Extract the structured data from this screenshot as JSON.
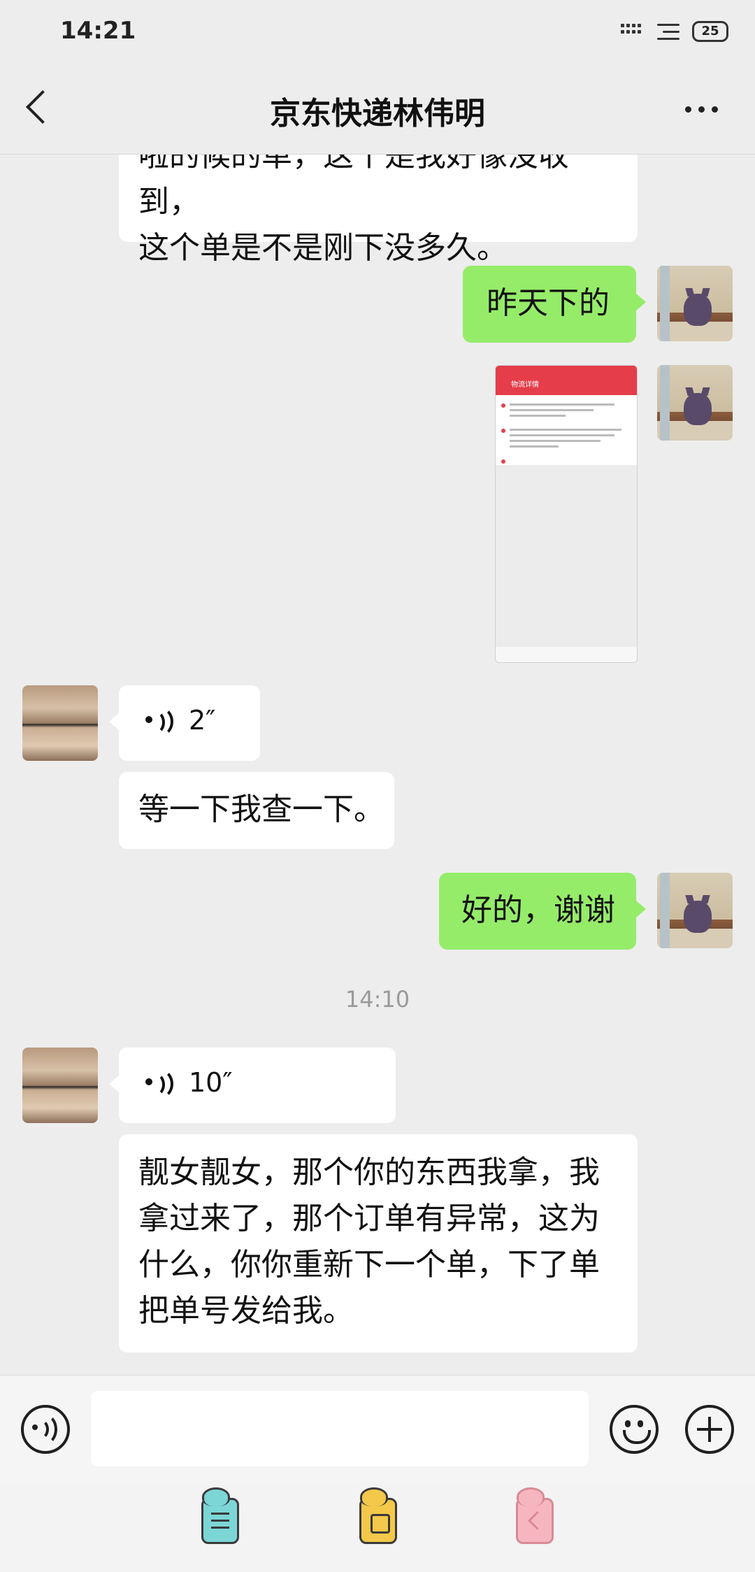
{
  "status_bar": {
    "time": "14:21",
    "battery": "25"
  },
  "header": {
    "title": "京东快递林伟明"
  },
  "messages": {
    "m1": {
      "line1": "啦的候的单，这个是我好像没收到，",
      "line2": "这个单是不是刚下没多久。"
    },
    "m2": {
      "text": "昨天下的"
    },
    "m3": {
      "screenshot_title": "物流详情"
    },
    "m4": {
      "duration": "2″"
    },
    "m5": {
      "text": "等一下我查一下。"
    },
    "m6": {
      "text": "好的，谢谢"
    },
    "time_divider": "14:10",
    "m7": {
      "duration": "10″"
    },
    "m8": {
      "line1": "靓女靓女，那个你的东西我拿，我",
      "line2": "拿过来了，那个订单有异常，这为",
      "line3": "什么，你你重新下一个单，下了单",
      "line4": "把单号发给我。"
    }
  },
  "input_bar": {
    "placeholder": ""
  }
}
